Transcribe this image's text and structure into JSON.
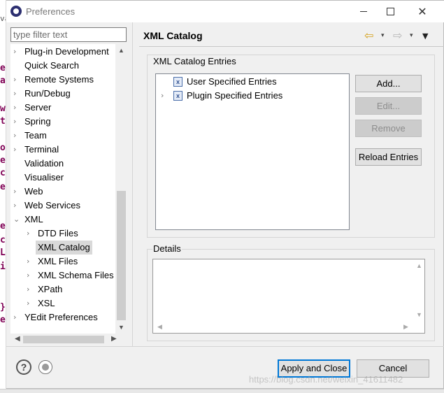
{
  "window": {
    "title": "Preferences"
  },
  "filter": {
    "placeholder": "type filter text"
  },
  "tree": {
    "items": [
      {
        "label": "Plug-in Development",
        "level": 0,
        "expandable": true
      },
      {
        "label": "Quick Search",
        "level": 0,
        "expandable": false
      },
      {
        "label": "Remote Systems",
        "level": 0,
        "expandable": true
      },
      {
        "label": "Run/Debug",
        "level": 0,
        "expandable": true
      },
      {
        "label": "Server",
        "level": 0,
        "expandable": true
      },
      {
        "label": "Spring",
        "level": 0,
        "expandable": true
      },
      {
        "label": "Team",
        "level": 0,
        "expandable": true
      },
      {
        "label": "Terminal",
        "level": 0,
        "expandable": true
      },
      {
        "label": "Validation",
        "level": 0,
        "expandable": false
      },
      {
        "label": "Visualiser",
        "level": 0,
        "expandable": false
      },
      {
        "label": "Web",
        "level": 0,
        "expandable": true
      },
      {
        "label": "Web Services",
        "level": 0,
        "expandable": true
      },
      {
        "label": "XML",
        "level": 0,
        "expandable": true,
        "expanded": true
      },
      {
        "label": "DTD Files",
        "level": 1,
        "expandable": true
      },
      {
        "label": "XML Catalog",
        "level": 1,
        "expandable": false,
        "selected": true
      },
      {
        "label": "XML Files",
        "level": 1,
        "expandable": true
      },
      {
        "label": "XML Schema Files",
        "level": 1,
        "expandable": true
      },
      {
        "label": "XPath",
        "level": 1,
        "expandable": true
      },
      {
        "label": "XSL",
        "level": 1,
        "expandable": true
      },
      {
        "label": "YEdit Preferences",
        "level": 0,
        "expandable": true
      }
    ]
  },
  "page": {
    "title": "XML Catalog"
  },
  "entries": {
    "legend": "XML Catalog Entries",
    "items": [
      {
        "label": "User Specified Entries",
        "expandable": false
      },
      {
        "label": "Plugin Specified Entries",
        "expandable": true
      }
    ]
  },
  "buttons": {
    "add": "Add...",
    "edit": "Edit...",
    "remove": "Remove",
    "reload": "Reload Entries",
    "apply_close": "Apply and Close",
    "cancel": "Cancel"
  },
  "details": {
    "legend": "Details"
  },
  "icons": {
    "help": "?",
    "back": "⇦",
    "forward": "⇨",
    "menu": "▾"
  },
  "watermark": "https://blog.csdn.net/weixin_41611482",
  "background_editor": {
    "chars": [
      "va",
      "e",
      "a",
      "w",
      "t",
      "o",
      "e",
      "c",
      "e",
      "e",
      "c",
      "L",
      "i",
      "}",
      "e"
    ]
  }
}
